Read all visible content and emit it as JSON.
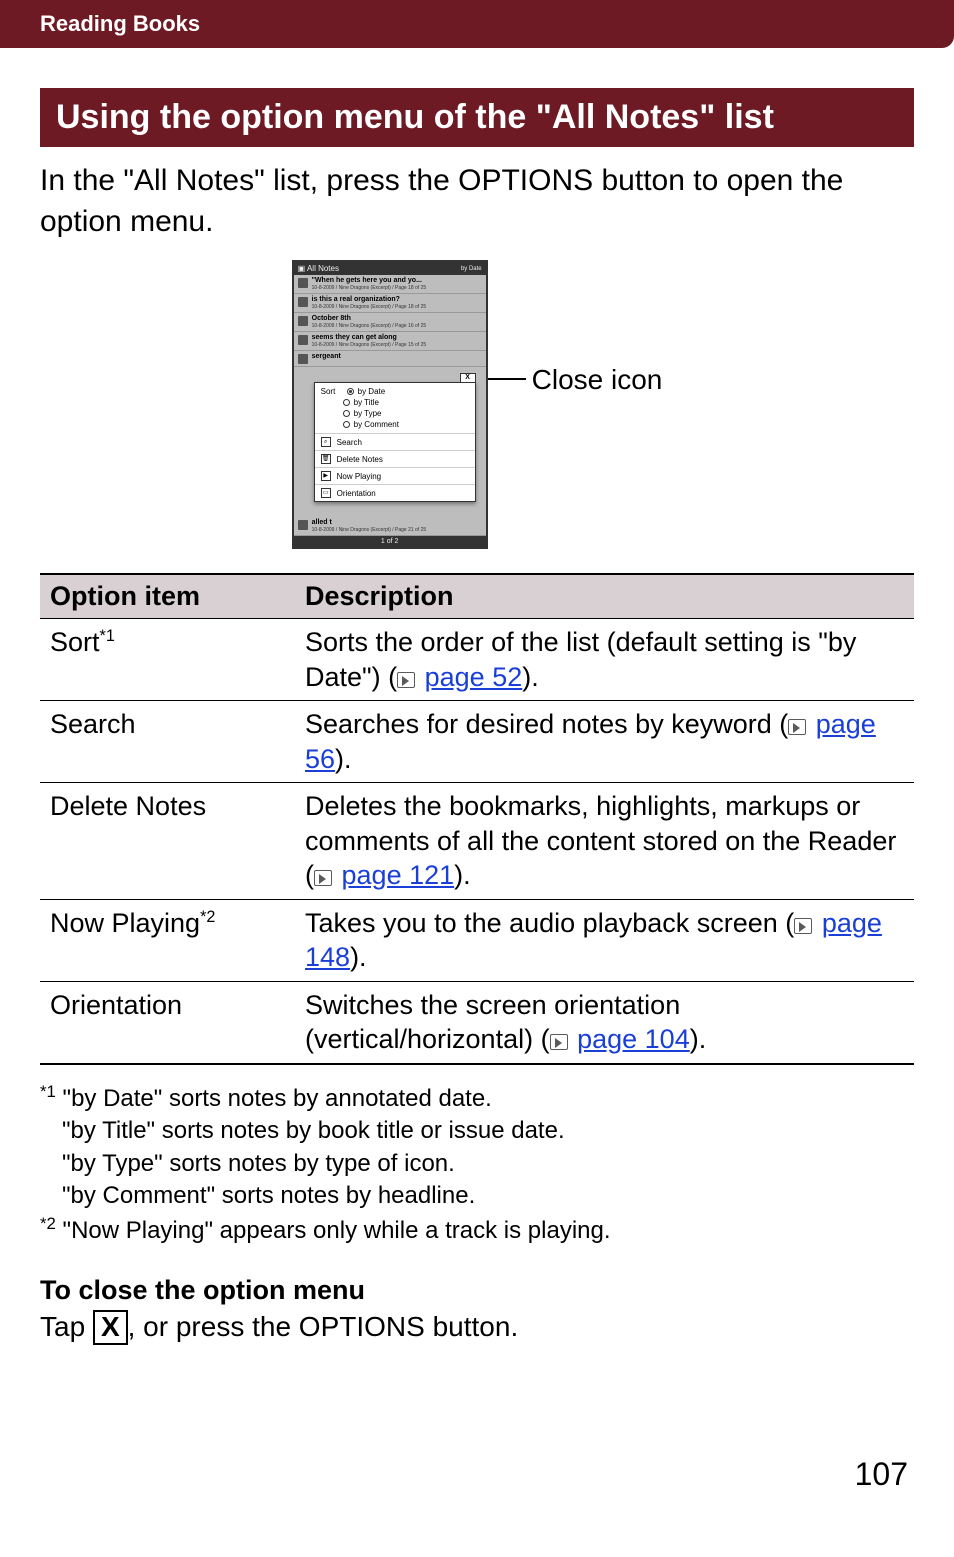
{
  "header": {
    "section": "Reading Books"
  },
  "title": "Using the option menu of the \"All Notes\" list",
  "intro": "In the \"All Notes\" list, press the OPTIONS button to open the option menu.",
  "callout": "Close icon",
  "screenshot": {
    "top_title": "All Notes",
    "top_right": "by Date",
    "rows": [
      {
        "title": "\"When he gets here you and yo...",
        "sub": "10-8-2009 / Nine Dragons (Excerpt) / Page 18 of 25"
      },
      {
        "title": "is this a real organization?",
        "sub": "10-8-2009 / Nine Dragons (Excerpt) / Page 18 of 25"
      },
      {
        "title": "October 8th",
        "sub": "10-8-2009 / Nine Dragons (Excerpt) / Page 16 of 25"
      },
      {
        "title": "seems they can get along",
        "sub": "10-8-2009 / Nine Dragons (Excerpt) / Page 15 of 25"
      },
      {
        "title": "sergeant",
        "sub": ""
      }
    ],
    "tail_row": {
      "title": "alled t",
      "sub": "10-8-2009 / Nine Dragons (Excerpt) / Page 21 of 25"
    },
    "menu": {
      "sort_label": "Sort",
      "sort_options": [
        "by Date",
        "by Title",
        "by Type",
        "by Comment"
      ],
      "sort_selected": 0,
      "items": [
        "Search",
        "Delete Notes",
        "Now Playing",
        "Orientation"
      ],
      "close": "X"
    },
    "footer": "1 of 2"
  },
  "table": {
    "head": [
      "Option item",
      "Description"
    ],
    "rows": [
      {
        "item": "Sort",
        "sup": "*1",
        "desc_a": "Sorts the order of the list (default setting is \"by Date\") (",
        "link": "page 52",
        "desc_b": ")."
      },
      {
        "item": "Search",
        "sup": "",
        "desc_a": "Searches for desired notes by keyword (",
        "link": "page 56",
        "desc_b": ")."
      },
      {
        "item": "Delete Notes",
        "sup": "",
        "desc_a": "Deletes the bookmarks, highlights, markups or comments of all the content stored on the Reader (",
        "link": "page 121",
        "desc_b": ")."
      },
      {
        "item": "Now Playing",
        "sup": "*2",
        "desc_a": "Takes you to the audio playback screen (",
        "link": "page 148",
        "desc_b": ")."
      },
      {
        "item": "Orientation",
        "sup": "",
        "desc_a": "Switches the screen orientation (vertical/horizontal) (",
        "link": "page 104",
        "desc_b": ")."
      }
    ]
  },
  "footnotes": {
    "f1_mark": "*1",
    "f1_lines": [
      "\"by Date\" sorts notes by annotated date.",
      "\"by Title\" sorts notes by book title or issue date.",
      "\"by Type\" sorts notes by type of icon.",
      "\"by Comment\" sorts notes by headline."
    ],
    "f2_mark": "*2",
    "f2_text": "\"Now Playing\" appears only while a track is playing."
  },
  "close_section": {
    "heading": "To close the option menu",
    "text_a": "Tap ",
    "x": "X",
    "text_b": ", or press the OPTIONS button."
  },
  "page_number": "107"
}
